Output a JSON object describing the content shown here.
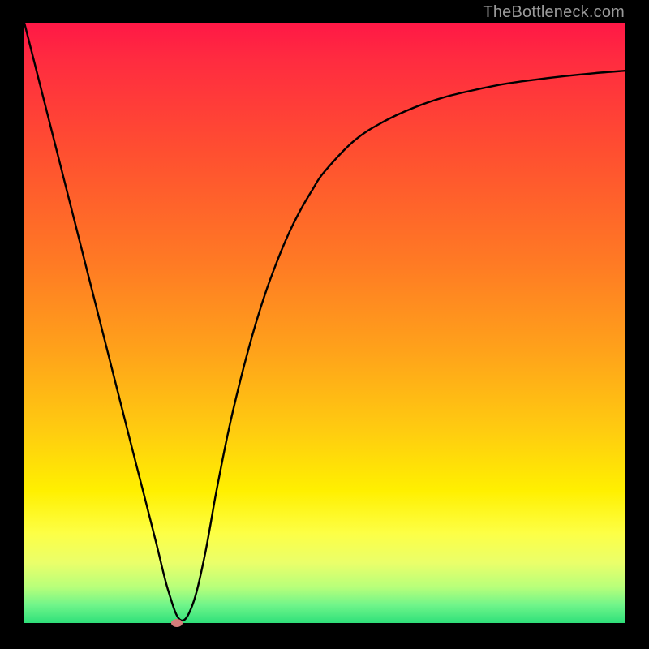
{
  "attribution": "TheBottleneck.com",
  "colors": {
    "gradient_top": "#ff1846",
    "gradient_bottom": "#2fe07a",
    "curve": "#000000",
    "marker": "#d57d7b",
    "frame": "#000000"
  },
  "chart_data": {
    "type": "line",
    "title": "",
    "xlabel": "",
    "ylabel": "",
    "xlim": [
      0,
      100
    ],
    "ylim": [
      0,
      100
    ],
    "grid": false,
    "x": [
      0,
      2,
      4,
      6,
      8,
      10,
      12,
      14,
      16,
      18,
      20,
      22,
      24,
      26,
      28,
      30,
      32,
      34,
      36,
      38,
      40,
      42,
      44,
      46,
      48,
      50,
      55,
      60,
      65,
      70,
      75,
      80,
      85,
      90,
      95,
      100
    ],
    "values": [
      100,
      92.1,
      84.2,
      76.3,
      68.4,
      60.5,
      52.6,
      44.7,
      36.8,
      28.9,
      21.1,
      13.2,
      5.3,
      0.5,
      3.0,
      11.0,
      22.0,
      32.0,
      40.5,
      48.0,
      54.5,
      60.0,
      64.8,
      68.8,
      72.2,
      75.2,
      80.4,
      83.6,
      85.9,
      87.6,
      88.8,
      89.8,
      90.5,
      91.1,
      91.6,
      92.0
    ],
    "annotations": [
      {
        "type": "marker",
        "x": 25.4,
        "y": 0,
        "label": ""
      }
    ],
    "legend": false
  }
}
